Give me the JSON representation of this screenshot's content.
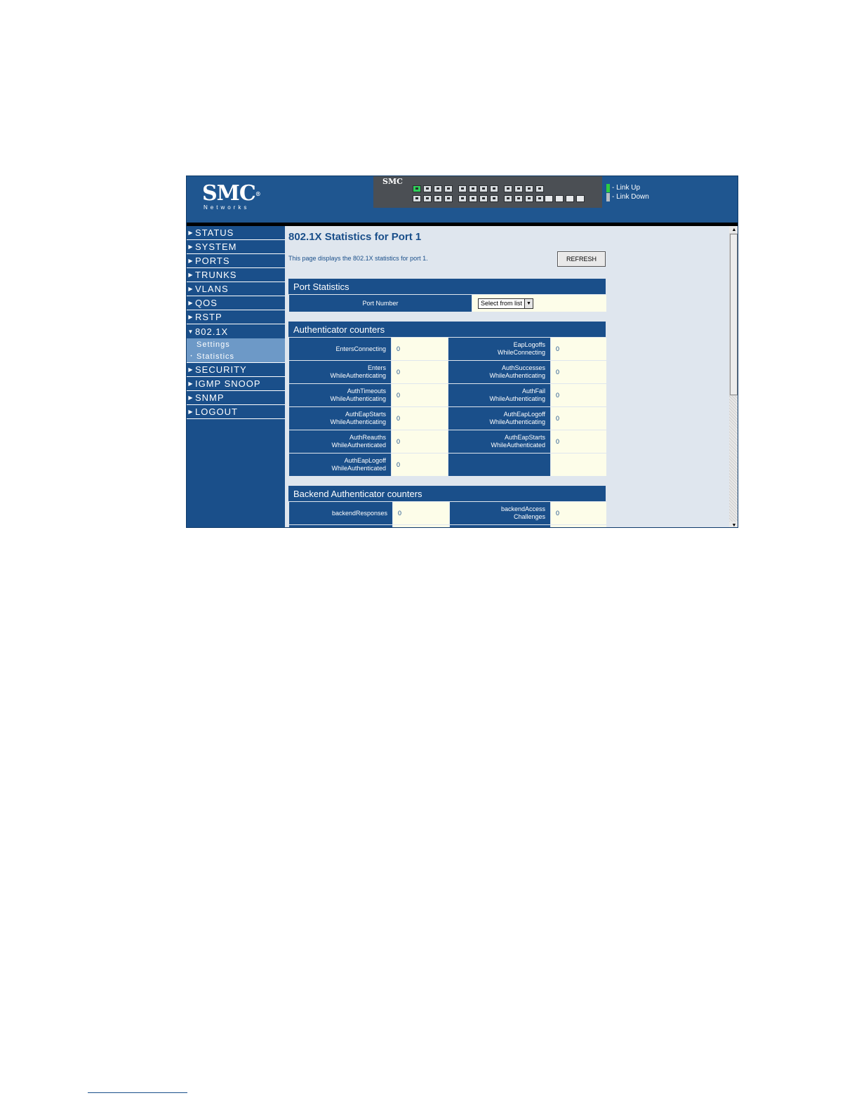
{
  "header": {
    "logo_brand": "SMC",
    "logo_reg": "®",
    "logo_sub": "Networks",
    "switch_brand": "SMC",
    "legend": [
      {
        "label": "- Link Up",
        "color": "#2ecc40"
      },
      {
        "label": "- Link Down",
        "color": "#b9bec4"
      }
    ]
  },
  "sidebar": {
    "items": [
      {
        "label": "STATUS"
      },
      {
        "label": "SYSTEM"
      },
      {
        "label": "PORTS"
      },
      {
        "label": "TRUNKS"
      },
      {
        "label": "VLANS"
      },
      {
        "label": "QOS"
      },
      {
        "label": "RSTP"
      },
      {
        "label": "802.1X"
      },
      {
        "label": "SECURITY"
      },
      {
        "label": "IGMP SNOOP"
      },
      {
        "label": "SNMP"
      },
      {
        "label": "LOGOUT"
      }
    ],
    "sub_items": [
      {
        "label": "Settings"
      },
      {
        "label": "Statistics"
      }
    ]
  },
  "main": {
    "title": "802.1X Statistics for Port 1",
    "description": "This page displays the 802.1X statistics for port 1.",
    "refresh_label": "REFRESH",
    "port_section": {
      "title": "Port Statistics",
      "label": "Port Number",
      "select_value": "Select from list"
    },
    "auth_section": {
      "title": "Authenticator counters",
      "rows": [
        [
          {
            "l1": "EntersConnecting",
            "l2": "",
            "value": "0"
          },
          {
            "l1": "EapLogoffs",
            "l2": "WhileConnecting",
            "value": "0"
          }
        ],
        [
          {
            "l1": "Enters",
            "l2": "WhileAuthenticating",
            "value": "0"
          },
          {
            "l1": "AuthSuccesses",
            "l2": "WhileAuthenticating",
            "value": "0"
          }
        ],
        [
          {
            "l1": "AuthTimeouts",
            "l2": "WhileAuthenticating",
            "value": "0"
          },
          {
            "l1": "AuthFail",
            "l2": "WhileAuthenticating",
            "value": "0"
          }
        ],
        [
          {
            "l1": "AuthEapStarts",
            "l2": "WhileAuthenticating",
            "value": "0"
          },
          {
            "l1": "AuthEapLogoff",
            "l2": "WhileAuthenticating",
            "value": "0"
          }
        ],
        [
          {
            "l1": "AuthReauths",
            "l2": "WhileAuthenticated",
            "value": "0"
          },
          {
            "l1": "AuthEapStarts",
            "l2": "WhileAuthenticated",
            "value": "0"
          }
        ],
        [
          {
            "l1": "AuthEapLogoff",
            "l2": "WhileAuthenticated",
            "value": "0"
          },
          {
            "l1": "",
            "l2": "",
            "value": ""
          }
        ]
      ]
    },
    "backend_section": {
      "title": "Backend Authenticator counters",
      "rows": [
        [
          {
            "l1": "backendResponses",
            "l2": "",
            "value": "0"
          },
          {
            "l1": "backendAccess",
            "l2": "Challenges",
            "value": "0"
          }
        ]
      ]
    }
  }
}
